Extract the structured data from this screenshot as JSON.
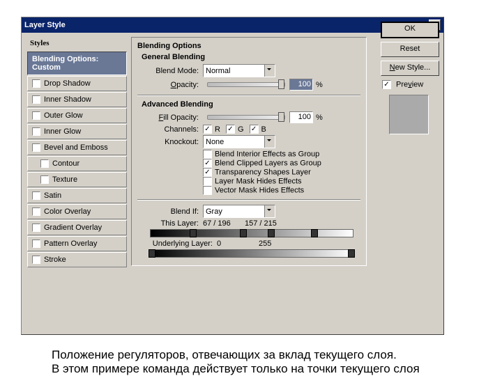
{
  "title": "Layer Style",
  "sidebar_header": "Styles",
  "sidebar": {
    "items": [
      {
        "label": "Blending Options: Custom",
        "selected": true
      },
      {
        "label": "Drop Shadow"
      },
      {
        "label": "Inner Shadow"
      },
      {
        "label": "Outer Glow"
      },
      {
        "label": "Inner Glow"
      },
      {
        "label": "Bevel and Emboss"
      },
      {
        "label": "Contour"
      },
      {
        "label": "Texture"
      },
      {
        "label": "Satin"
      },
      {
        "label": "Color Overlay"
      },
      {
        "label": "Gradient Overlay"
      },
      {
        "label": "Pattern Overlay"
      },
      {
        "label": "Stroke"
      }
    ]
  },
  "main": {
    "hdr": "Blending Options",
    "general": "General Blending",
    "blendmode_lbl": "Blend Mode:",
    "blendmode_val": "Normal",
    "opacity_lbl": "Opacity:",
    "opacity_val": "100",
    "pct": "%",
    "advanced": "Advanced Blending",
    "fillop_lbl": "Fill Opacity:",
    "fillop_val": "100",
    "channels_lbl": "Channels:",
    "ch": {
      "r": "R",
      "g": "G",
      "b": "B"
    },
    "knockout_lbl": "Knockout:",
    "knockout_val": "None",
    "opts": {
      "o1": {
        "on": false,
        "label": "Blend Interior Effects as Group"
      },
      "o2": {
        "on": true,
        "label": "Blend Clipped Layers as Group"
      },
      "o3": {
        "on": true,
        "label": "Transparency Shapes Layer"
      },
      "o4": {
        "on": false,
        "label": "Layer Mask Hides Effects"
      },
      "o5": {
        "on": false,
        "label": "Vector Mask Hides Effects"
      }
    },
    "blendif_lbl": "Blend If:",
    "blendif_val": "Gray",
    "thislayer_lbl": "This Layer:",
    "thislayer_a": "67 / 196",
    "thislayer_b": "157 / 215",
    "under_lbl": "Underlying Layer:",
    "under_a": "0",
    "under_b": "255"
  },
  "buttons": {
    "ok": "OK",
    "reset": "Reset",
    "newstyle": "New Style...",
    "preview": "Preview"
  },
  "caption_l1": "Положение регуляторов, отвечающих за вклад текущего слоя.",
  "caption_l2": "В этом примере команда действует только на точки текущего слоя"
}
